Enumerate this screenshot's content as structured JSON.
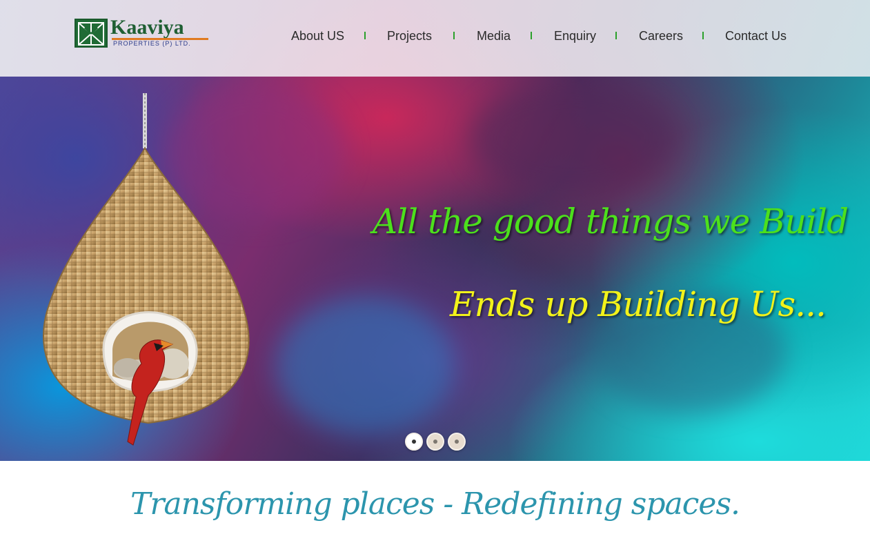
{
  "brand": {
    "name": "Kaaviya",
    "subtitle": "PROPERTIES (P) LTD."
  },
  "nav": {
    "items": [
      {
        "label": "About US"
      },
      {
        "label": "Projects"
      },
      {
        "label": "Media"
      },
      {
        "label": "Enquiry"
      },
      {
        "label": "Careers"
      },
      {
        "label": "Contact Us"
      }
    ]
  },
  "hero": {
    "line1": "All the good things we Build",
    "line2": "Ends up Building Us...",
    "slides": {
      "count": 3,
      "active": 1
    }
  },
  "slogan": "Transforming places - Redefining spaces.",
  "colors": {
    "brand_green": "#1f6b35",
    "accent_orange": "#e07a20",
    "tagline_green": "#4ce01c",
    "tagline_yellow": "#f2f21a",
    "slogan_blue": "#2c95ad",
    "nav_separator": "#2aa02a"
  },
  "icons": {
    "hero_image": "hanging-nest-chair-with-cardinal-bird"
  }
}
